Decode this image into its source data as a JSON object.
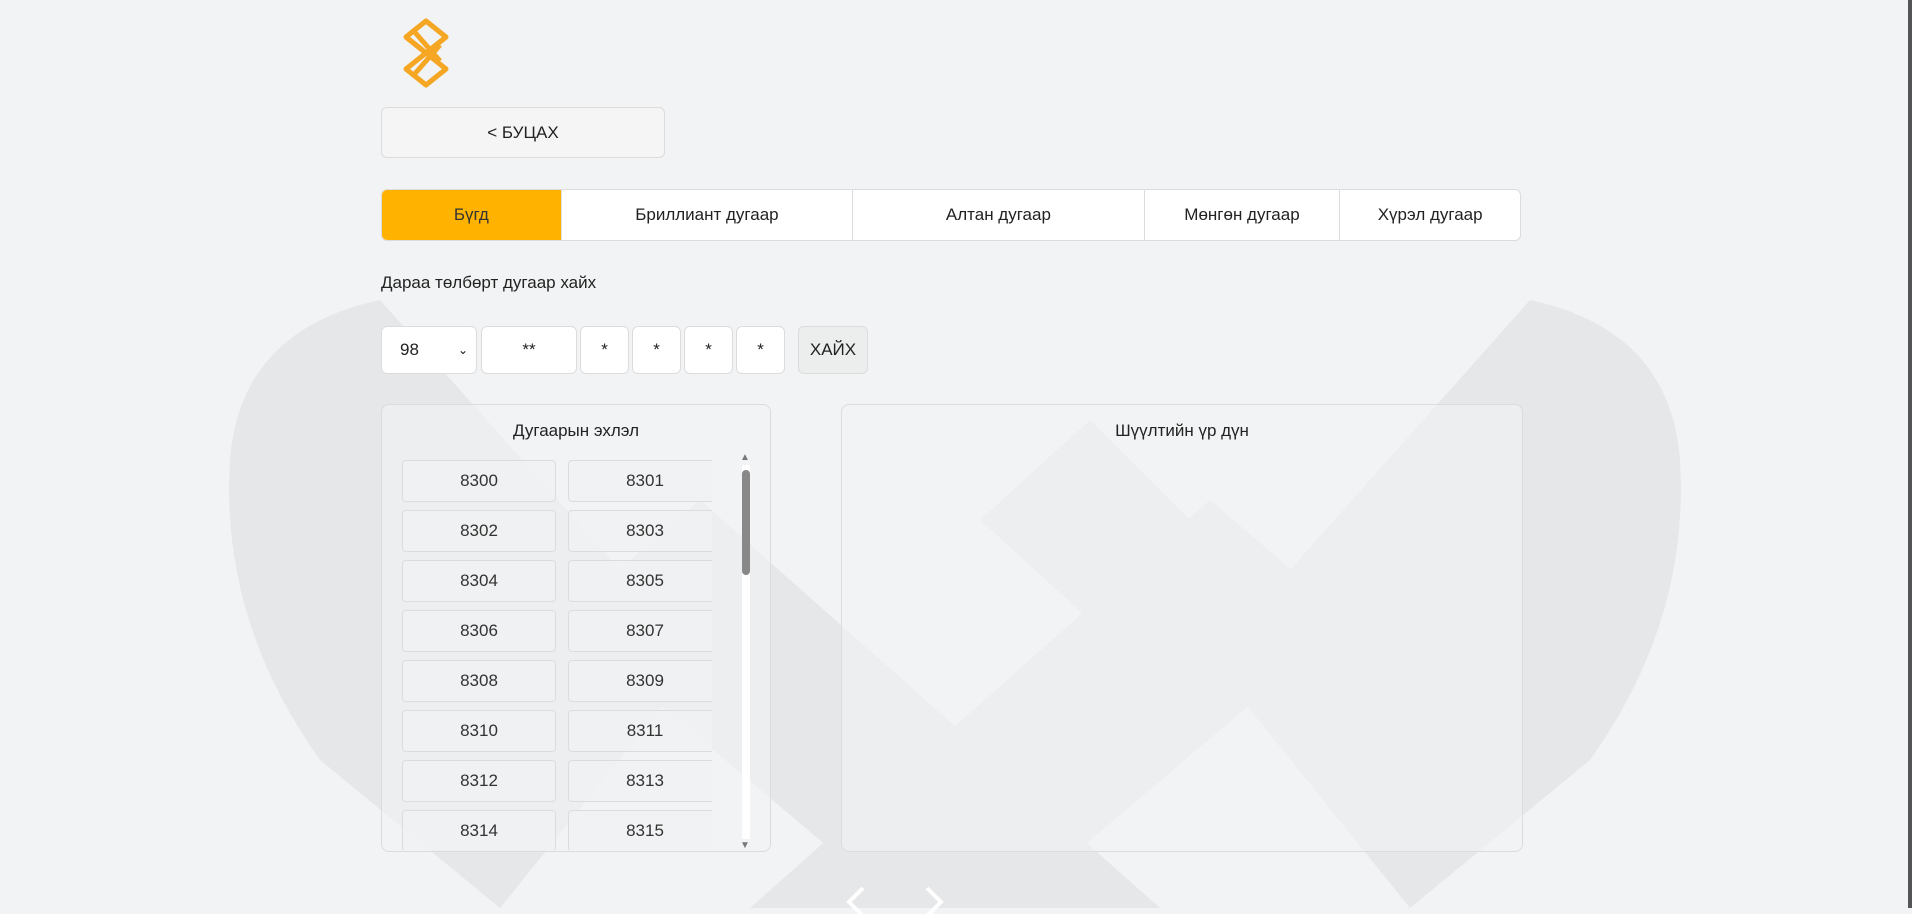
{
  "back_button": {
    "label": "< БУЦАХ"
  },
  "tabs": [
    {
      "label": "Бүгд",
      "active": true
    },
    {
      "label": "Бриллиант дугаар",
      "active": false
    },
    {
      "label": "Алтан дугаар",
      "active": false
    },
    {
      "label": "Мөнгөн дугаар",
      "active": false
    },
    {
      "label": "Хүрэл дугаар",
      "active": false
    }
  ],
  "search": {
    "label": "Дараа төлбөрт дугаар хайх",
    "prefix_selected": "98",
    "fields": [
      "**",
      "*",
      "*",
      "*",
      "*"
    ],
    "button_label": "ХАЙХ"
  },
  "prefix_panel": {
    "title": "Дугаарын эхлэл",
    "items": [
      "8300",
      "8301",
      "8302",
      "8303",
      "8304",
      "8305",
      "8306",
      "8307",
      "8308",
      "8309",
      "8310",
      "8311",
      "8312",
      "8313",
      "8314",
      "8315"
    ]
  },
  "result_panel": {
    "title": "Шүүлтийн үр дүн"
  },
  "icons": {
    "logo": "knot-logo-icon",
    "prev": "chevron-left-icon",
    "next": "chevron-right-icon",
    "select_chevron": "chevron-down-icon"
  },
  "colors": {
    "accent": "#ffb300",
    "background": "#f2f3f4",
    "border": "#dcdcdc"
  }
}
